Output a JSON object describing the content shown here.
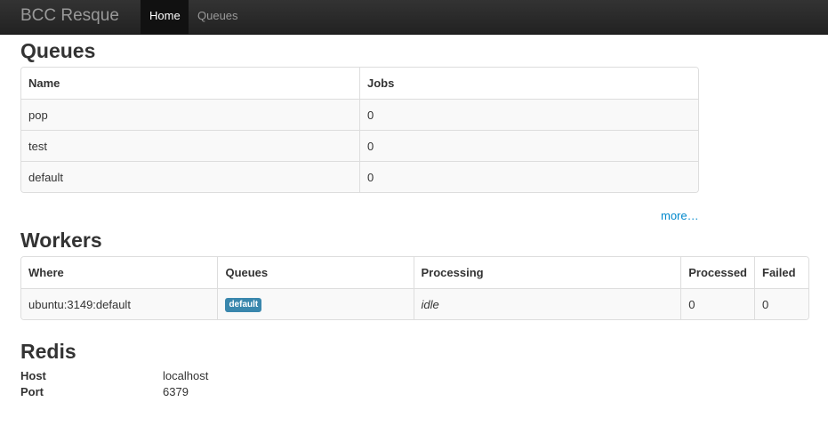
{
  "navbar": {
    "brand": "BCC Resque",
    "items": [
      {
        "label": "Home",
        "active": true
      },
      {
        "label": "Queues",
        "active": false
      }
    ]
  },
  "queues": {
    "title": "Queues",
    "columns": [
      "Name",
      "Jobs"
    ],
    "rows": [
      {
        "name": "pop",
        "jobs": "0"
      },
      {
        "name": "test",
        "jobs": "0"
      },
      {
        "name": "default",
        "jobs": "0"
      }
    ],
    "more_label": "more…"
  },
  "workers": {
    "title": "Workers",
    "columns": [
      "Where",
      "Queues",
      "Processing",
      "Processed",
      "Failed"
    ],
    "rows": [
      {
        "where": "ubuntu:3149:default",
        "queue_badge": "default",
        "processing": "idle",
        "processed": "0",
        "failed": "0"
      }
    ]
  },
  "redis": {
    "title": "Redis",
    "items": [
      {
        "label": "Host",
        "value": "localhost"
      },
      {
        "label": "Port",
        "value": "6379"
      }
    ]
  },
  "colors": {
    "navbar_bg": "#222222",
    "link": "#0088cc",
    "badge_info": "#3a87ad"
  }
}
